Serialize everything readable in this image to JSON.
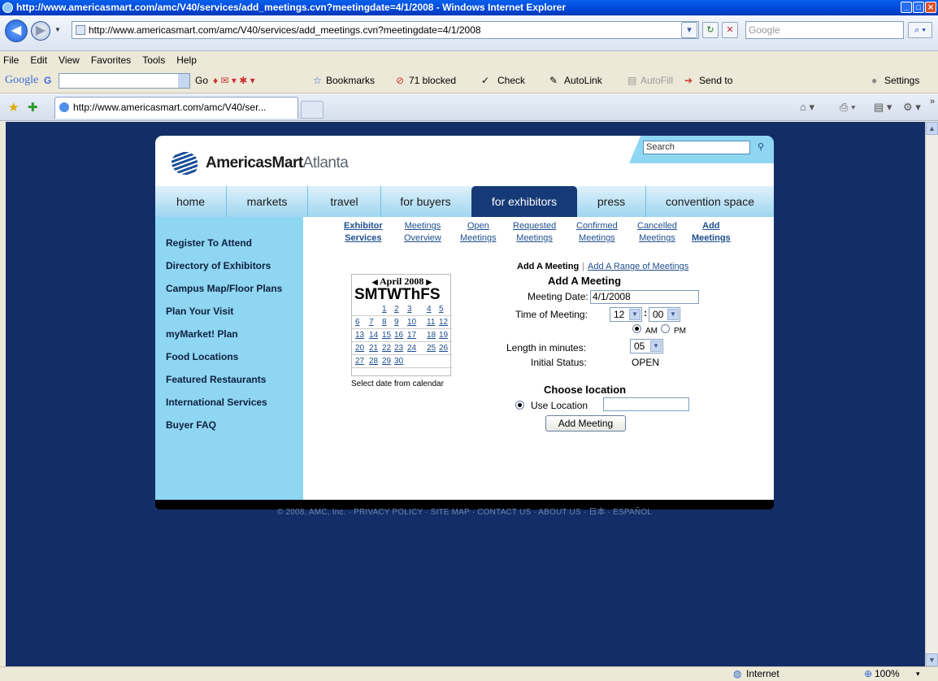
{
  "window": {
    "title": "http://www.americasmart.com/amc/V40/services/add_meetings.cvn?meetingdate=4/1/2008 - Windows Internet Explorer",
    "address": "http://www.americasmart.com/amc/V40/services/add_meetings.cvn?meetingdate=4/1/2008",
    "search_placeholder": "Google",
    "tab_label": "http://www.americasmart.com/amc/V40/ser..."
  },
  "menu": [
    "File",
    "Edit",
    "View",
    "Favorites",
    "Tools",
    "Help"
  ],
  "toolbar": {
    "google_logo": "Google",
    "google_g": "G",
    "go": "Go",
    "bookmarks": "Bookmarks",
    "blocked": "71 blocked",
    "check": "Check",
    "autolink": "AutoLink",
    "autofill": "AutoFill",
    "sendto": "Send to",
    "settings": "Settings"
  },
  "status": {
    "zone": "Internet",
    "zoom": "100%"
  },
  "site": {
    "brand": "AmericasMart",
    "brand_city": "Atlanta",
    "search_label": "Search",
    "nav": [
      "home",
      "markets",
      "travel",
      "for buyers",
      "for exhibitors",
      "press",
      "convention space"
    ],
    "nav_active": "for exhibitors",
    "sidebar": [
      "Register To Attend",
      "Directory of Exhibitors",
      "Campus Map/Floor Plans",
      "Plan Your Visit",
      "myMarket! Plan",
      "Food Locations",
      "Featured Restaurants",
      "International Services",
      "Buyer FAQ"
    ],
    "subnav": [
      {
        "l1": "Exhibitor",
        "l2": "Services"
      },
      {
        "l1": "Meetings",
        "l2": "Overview"
      },
      {
        "l1": "Open",
        "l2": "Meetings"
      },
      {
        "l1": "Requested",
        "l2": "Meetings"
      },
      {
        "l1": "Confirmed",
        "l2": "Meetings"
      },
      {
        "l1": "Cancelled",
        "l2": "Meetings"
      },
      {
        "l1": "Add",
        "l2": "Meetings"
      }
    ],
    "crumb_current": "Add A Meeting",
    "crumb_link": "Add A Range of Meetings",
    "calendar": {
      "month": "April 2008",
      "prev": "◀",
      "next": "▶",
      "days_header": "SMTWThFS",
      "weeks": [
        [
          "",
          "",
          "1",
          "2",
          "3",
          "4",
          "5"
        ],
        [
          "6",
          "7",
          "8",
          "9",
          "10",
          "11",
          "12"
        ],
        [
          "13",
          "14",
          "15",
          "16",
          "17",
          "18",
          "19"
        ],
        [
          "20",
          "21",
          "22",
          "23",
          "24",
          "25",
          "26"
        ],
        [
          "27",
          "28",
          "29",
          "30",
          "",
          "",
          ""
        ]
      ],
      "caption": "Select date from calendar"
    },
    "form": {
      "title": "Add A Meeting",
      "date_label": "Meeting Date:",
      "date_value": "4/1/2008",
      "time_label": "Time of Meeting:",
      "hour": "12",
      "minute": "00",
      "am": "AM",
      "pm": "PM",
      "length_label": "Length in minutes:",
      "length": "05",
      "status_label": "Initial Status:",
      "status_value": "OPEN",
      "location_title": "Choose location",
      "use_location": "Use Location",
      "submit": "Add Meeting"
    },
    "footer": "© 2008, AMC, Inc.  ·  PRIVACY POLICY  ·  SITE MAP  ·  CONTACT US  ·  ABOUT US  ·  日本  ·  ESPAÑOL"
  }
}
